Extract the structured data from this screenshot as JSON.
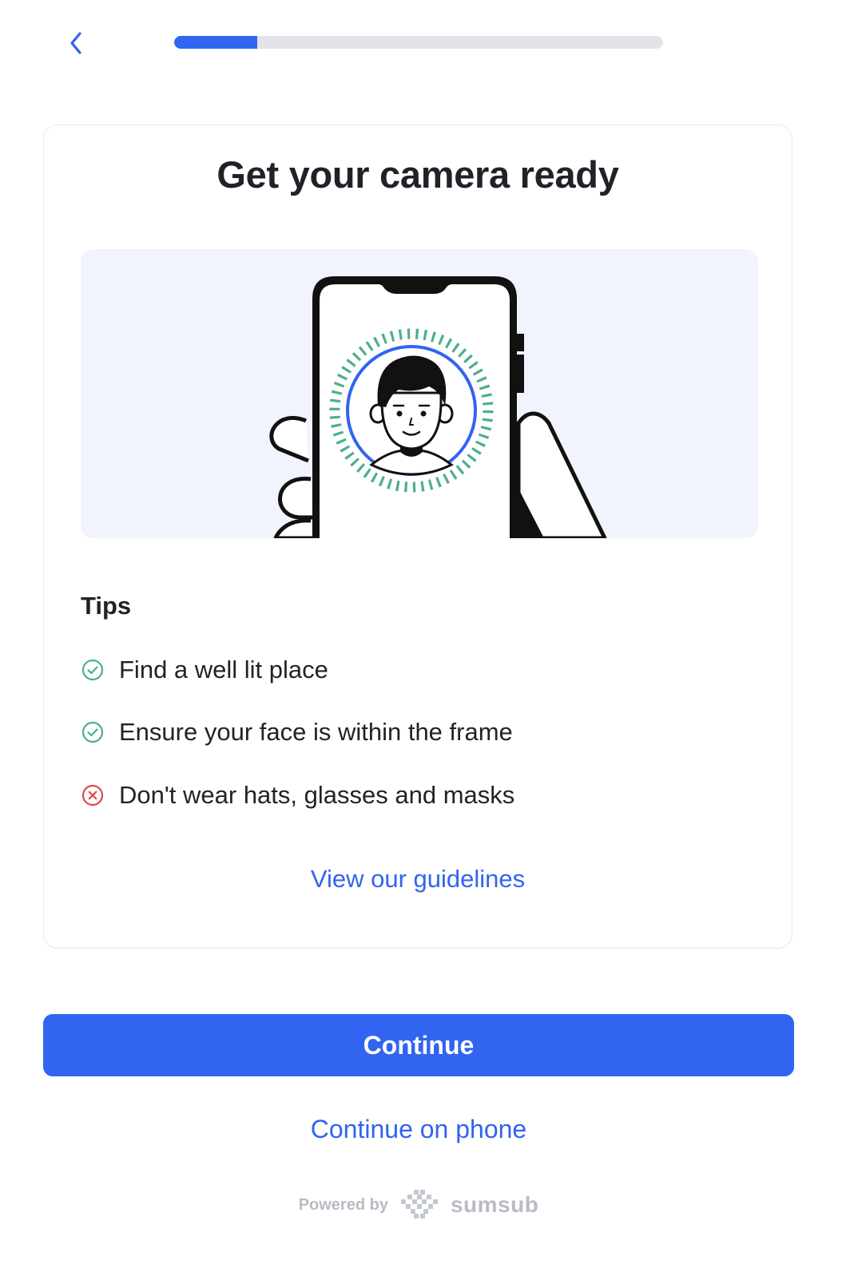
{
  "header": {
    "progress_percent": 17
  },
  "card": {
    "title": "Get your camera ready",
    "tips_heading": "Tips",
    "tips": [
      {
        "text": "Find a well lit place",
        "kind": "do",
        "icon": "check-circle-icon"
      },
      {
        "text": "Ensure your face is within the frame",
        "kind": "do",
        "icon": "check-circle-icon"
      },
      {
        "text": "Don't wear hats, glasses and masks",
        "kind": "dont",
        "icon": "x-circle-icon"
      }
    ],
    "guidelines_link": "View our guidelines"
  },
  "actions": {
    "continue_label": "Continue",
    "continue_on_phone_label": "Continue on phone"
  },
  "footer": {
    "powered_by": "Powered by",
    "brand": "sumsub"
  },
  "colors": {
    "accent": "#3164f0",
    "success": "#4caf8a",
    "danger": "#e0484e",
    "illustration_bg": "#f1f4fc"
  }
}
